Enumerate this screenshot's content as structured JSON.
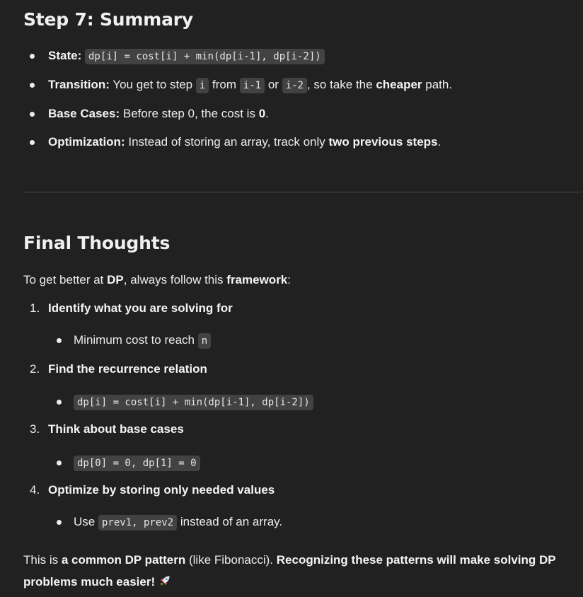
{
  "summary": {
    "heading": "Step 7: Summary",
    "items": [
      {
        "label": "State:",
        "code": "dp[i] = cost[i] + min(dp[i-1], dp[i-2])"
      },
      {
        "label": "Transition:",
        "text1": "You get to step",
        "code1": "i",
        "text2": "from",
        "code2": "i-1",
        "text3": "or",
        "code3": "i-2",
        "text4": ", so take the",
        "strong": "cheaper",
        "text5": "path."
      },
      {
        "label": "Base Cases:",
        "text1": "Before step 0, the cost is",
        "strong": "0",
        "text2": "."
      },
      {
        "label": "Optimization:",
        "text1": "Instead of storing an array, track only",
        "strong": "two previous steps",
        "text2": "."
      }
    ]
  },
  "final": {
    "heading": "Final Thoughts",
    "intro": {
      "text1": "To get better at",
      "strong1": "DP",
      "text2": ", always follow this",
      "strong2": "framework",
      "text3": ":"
    },
    "steps": [
      {
        "num": "1.",
        "title": "Identify what you are solving for",
        "sub_text": "Minimum cost to reach",
        "sub_code": "n"
      },
      {
        "num": "2.",
        "title": "Find the recurrence relation",
        "sub_code": "dp[i] = cost[i] + min(dp[i-1], dp[i-2])"
      },
      {
        "num": "3.",
        "title": "Think about base cases",
        "sub_code": "dp[0] = 0, dp[1] = 0"
      },
      {
        "num": "4.",
        "title": "Optimize by storing only needed values",
        "sub_text": "Use",
        "sub_code": "prev1, prev2",
        "sub_text2": "instead of an array."
      }
    ],
    "closing": {
      "text1": "This is",
      "strong1": "a common DP pattern",
      "text2": "(like Fibonacci).",
      "strong2": "Recognizing these patterns will make solving DP problems much easier!",
      "emoji": "rocket-icon"
    }
  }
}
